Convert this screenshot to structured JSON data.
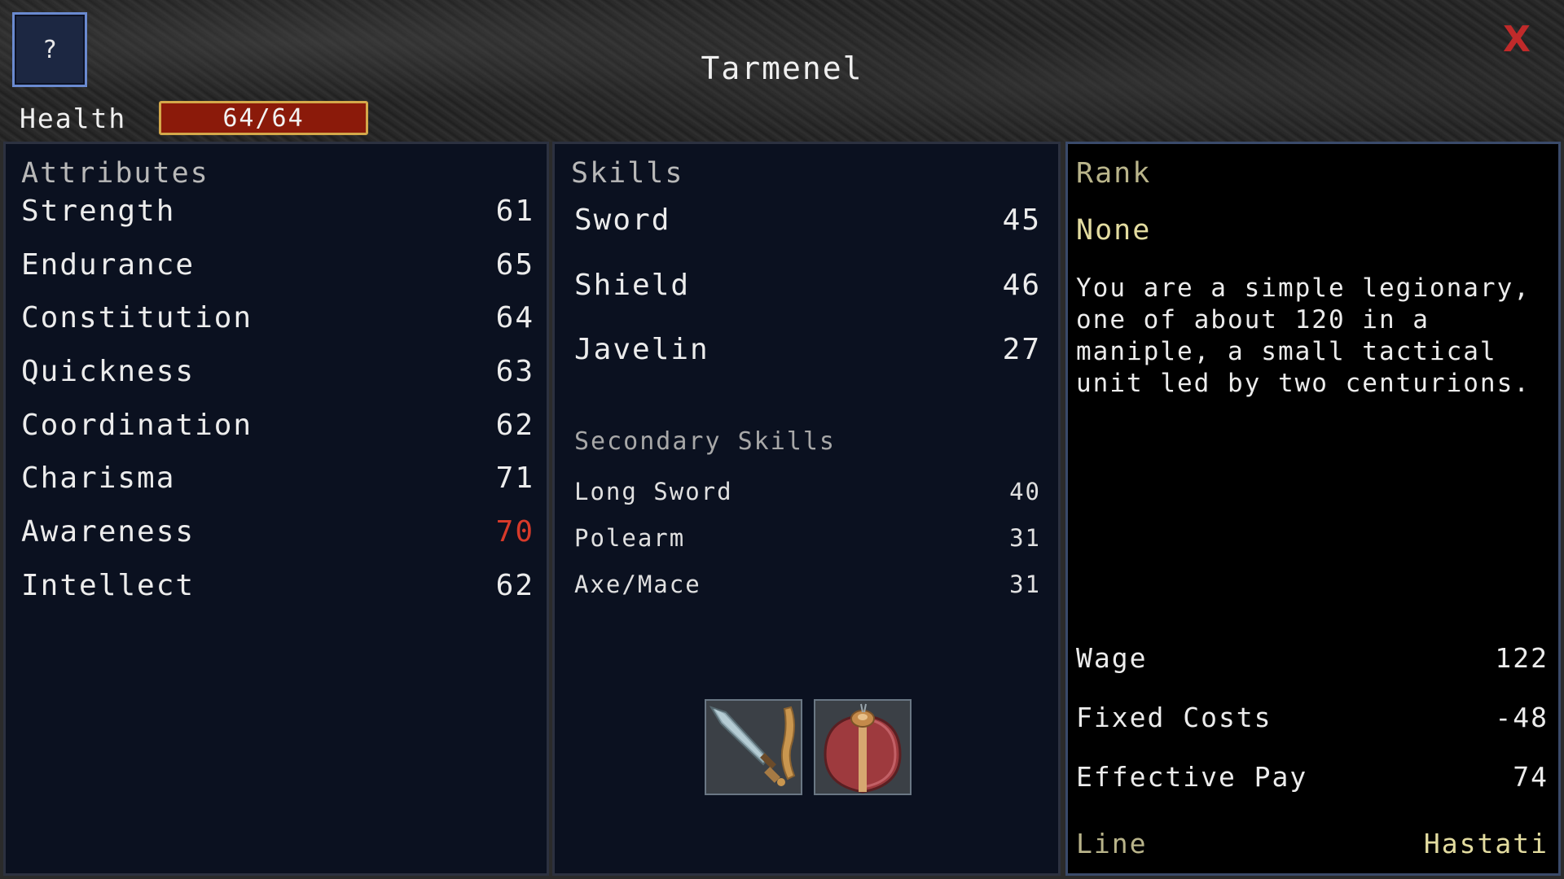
{
  "header": {
    "help_label": "?",
    "close_label": "X",
    "character_name": "Tarmenel",
    "health_label": "Health",
    "health_text": "64/64",
    "health_fraction": 1.0
  },
  "attributes": {
    "title": "Attributes",
    "items": [
      {
        "label": "Strength",
        "value": "61"
      },
      {
        "label": "Endurance",
        "value": "65"
      },
      {
        "label": "Constitution",
        "value": "64"
      },
      {
        "label": "Quickness",
        "value": "63"
      },
      {
        "label": "Coordination",
        "value": "62"
      },
      {
        "label": "Charisma",
        "value": "71"
      },
      {
        "label": "Awareness",
        "value": "70"
      },
      {
        "label": "Intellect",
        "value": "62"
      }
    ]
  },
  "skills": {
    "title": "Skills",
    "items": [
      {
        "label": "Sword",
        "value": "45"
      },
      {
        "label": "Shield",
        "value": "46"
      },
      {
        "label": "Javelin",
        "value": "27"
      }
    ],
    "secondary_title": "Secondary Skills",
    "secondary": [
      {
        "label": "Long Sword",
        "value": "40"
      },
      {
        "label": "Polearm",
        "value": "31"
      },
      {
        "label": "Axe/Mace",
        "value": "31"
      }
    ],
    "equipment": [
      {
        "icon": "gladius-sword-icon"
      },
      {
        "icon": "scutum-shield-icon"
      }
    ]
  },
  "rank": {
    "title": "Rank",
    "value": "None",
    "description": "You are a simple legionary, one of about 120 in a maniple, a small tactical unit led by two centurions.",
    "wage_label": "Wage",
    "wage_value": "122",
    "fixed_costs_label": "Fixed Costs",
    "fixed_costs_value": "-48",
    "effective_pay_label": "Effective Pay",
    "effective_pay_value": "74",
    "line_label": "Line",
    "line_value": "Hastati"
  },
  "colors": {
    "panel_bg": "#0b1120",
    "highlight_red": "#d83a2a",
    "gold_text": "#e3dca0",
    "health_bar": "#7a1208"
  }
}
